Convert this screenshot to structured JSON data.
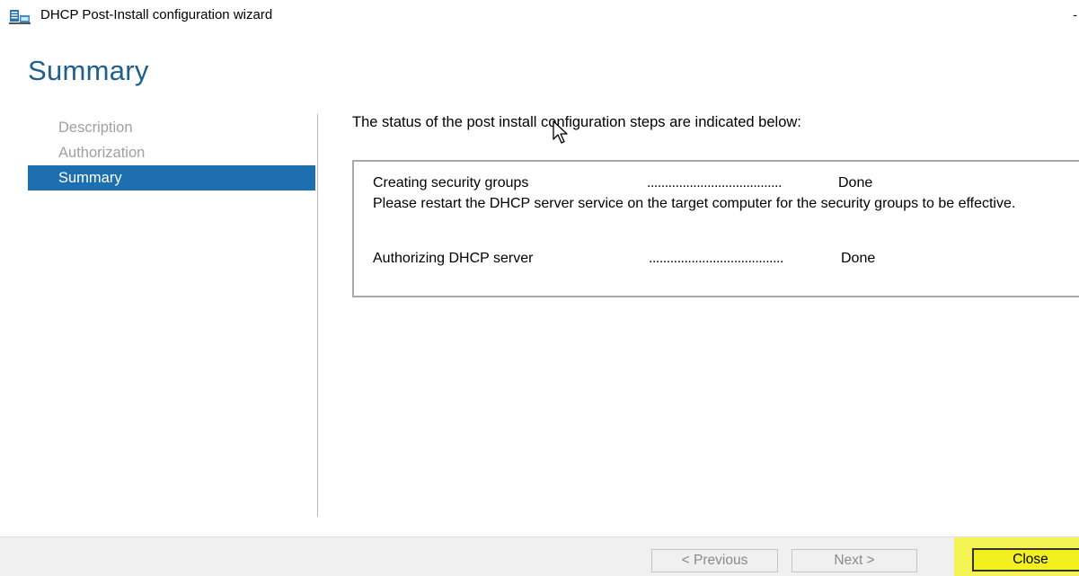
{
  "window": {
    "title": "DHCP Post-Install configuration wizard",
    "control_glyph": "-",
    "icon": "server-network-icon"
  },
  "page": {
    "heading": "Summary"
  },
  "nav": {
    "items": [
      {
        "label": "Description",
        "state": "disabled"
      },
      {
        "label": "Authorization",
        "state": "disabled"
      },
      {
        "label": "Summary",
        "state": "active"
      }
    ]
  },
  "content": {
    "intro": "The status of the post install configuration steps are indicated below:",
    "steps": [
      {
        "name": "Creating security groups",
        "dots": "......................................",
        "status": "Done"
      },
      {
        "name": "Authorizing DHCP server",
        "dots": "......................................",
        "status": "Done"
      }
    ],
    "note": "Please restart the DHCP server service on the target computer for the security groups to be effective."
  },
  "buttons": {
    "previous": "< Previous",
    "next": "Next >",
    "close": "Close"
  },
  "colors": {
    "heading": "#1e5f8c",
    "nav_active_bg": "#1e6fb0",
    "highlight": "#f2f01e"
  }
}
